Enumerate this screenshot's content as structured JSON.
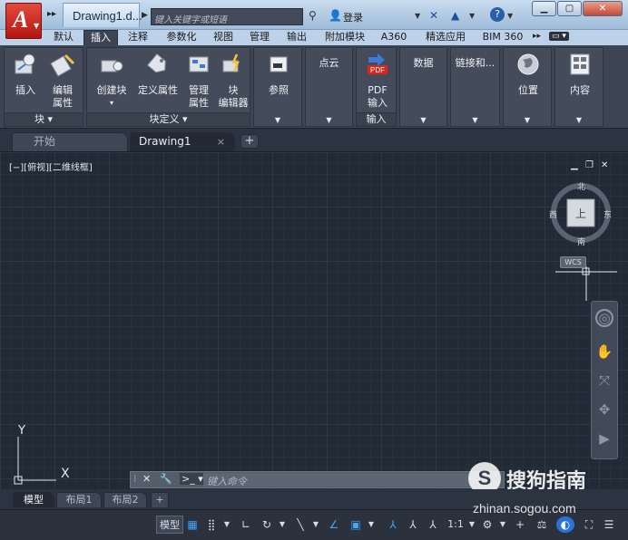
{
  "titlebar": {
    "app_letter": "A",
    "doc_tab": "Drawing1.d...",
    "search_placeholder": "键入关键字或短语",
    "login": "登录",
    "help": "?"
  },
  "ribbon_tabs": [
    "默认",
    "插入",
    "注释",
    "参数化",
    "视图",
    "管理",
    "输出",
    "附加模块",
    "A360",
    "精选应用",
    "BIM 360"
  ],
  "active_tab": "插入",
  "panels": {
    "block": {
      "title": "块",
      "buttons": [
        "插入",
        "编辑\n属性"
      ]
    },
    "block_def": {
      "title": "块定义",
      "buttons": [
        "创建块",
        "定义属性",
        "管理\n属性",
        "块\n编辑器"
      ]
    },
    "reference": {
      "button": "参照"
    },
    "pointcloud": {
      "label": "点云"
    },
    "import": {
      "title": "输入",
      "button": "PDF\n输入",
      "pdf_badge": "PDF"
    },
    "data": {
      "label": "数据"
    },
    "linking": {
      "label": "链接和..."
    },
    "location": {
      "button": "位置"
    },
    "content": {
      "button": "内容"
    }
  },
  "file_tabs": {
    "start": "开始",
    "drawing": "Drawing1",
    "close": "×",
    "add": "+"
  },
  "viewport": {
    "label": "[−][俯视][二维线框]",
    "viewcube": {
      "north": "北",
      "south": "南",
      "east": "东",
      "west": "西",
      "face": "上",
      "wcs": "WCS"
    },
    "ucs": {
      "y": "Y",
      "x": "X"
    }
  },
  "command_line": {
    "placeholder": "键入命令"
  },
  "watermark": {
    "logo": "S",
    "name": "搜狗指南",
    "url": "zhinan.sogou.com"
  },
  "layout_tabs": [
    "模型",
    "布局1",
    "布局2"
  ],
  "statusbar": {
    "model": "模型",
    "scale": "1:1"
  },
  "colors": {
    "accent": "#3ea6ff",
    "app_red": "#c8281c",
    "ribbon_bg": "#3d4554",
    "canvas_bg": "#222a36"
  }
}
